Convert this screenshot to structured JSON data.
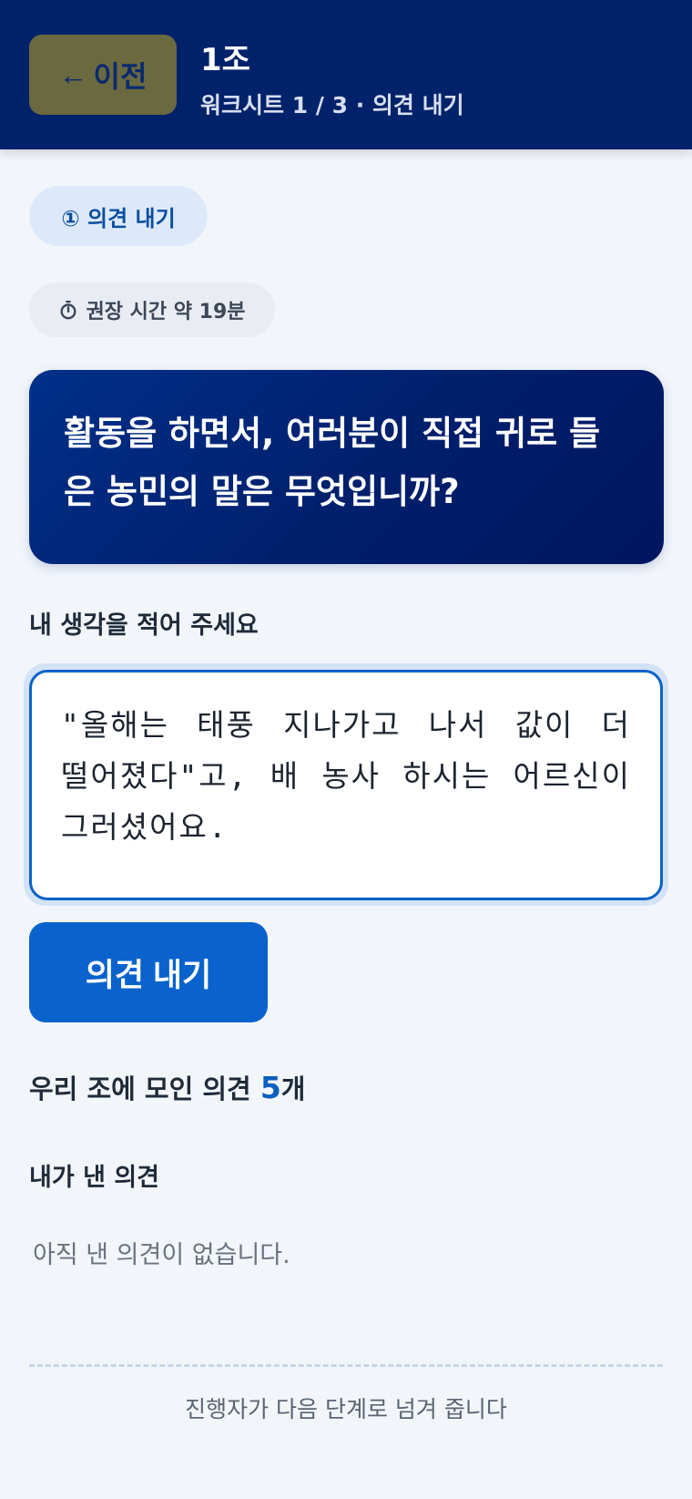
{
  "header": {
    "back_arrow": "←",
    "back_label": "이전",
    "group_title": "1조",
    "subtitle": "워크시트 1 / 3 · 의견 내기"
  },
  "step": {
    "label": "① 의견 내기"
  },
  "timer": {
    "icon": "stopwatch-icon",
    "label": "권장 시간 약 19분"
  },
  "question": {
    "text": "활동을 하면서, 여러분이 직접 귀로 들은 농민의 말은 무엇입니까?"
  },
  "answer": {
    "label": "내 생각을 적어 주세요",
    "value": "\"올해는 태풍 지나가고 나서 값이 더 떨어졌다\"고, 배 농사 하시는 어르신이 그러셨어요."
  },
  "submit": {
    "label": "의견 내기"
  },
  "summary": {
    "prefix": "우리 조에 모인 의견 ",
    "count": "5",
    "suffix": "개"
  },
  "mine": {
    "title": "내가 낸 의견",
    "empty": "아직 낸 의견이 없습니다."
  },
  "footer": {
    "note": "진행자가 다음 단계로 넘겨 줍니다"
  },
  "colors": {
    "header_bg": "#00226a",
    "accent": "#0a63cc",
    "back_button_bg": "#6b6940",
    "page_bg": "#f2f6fb"
  }
}
